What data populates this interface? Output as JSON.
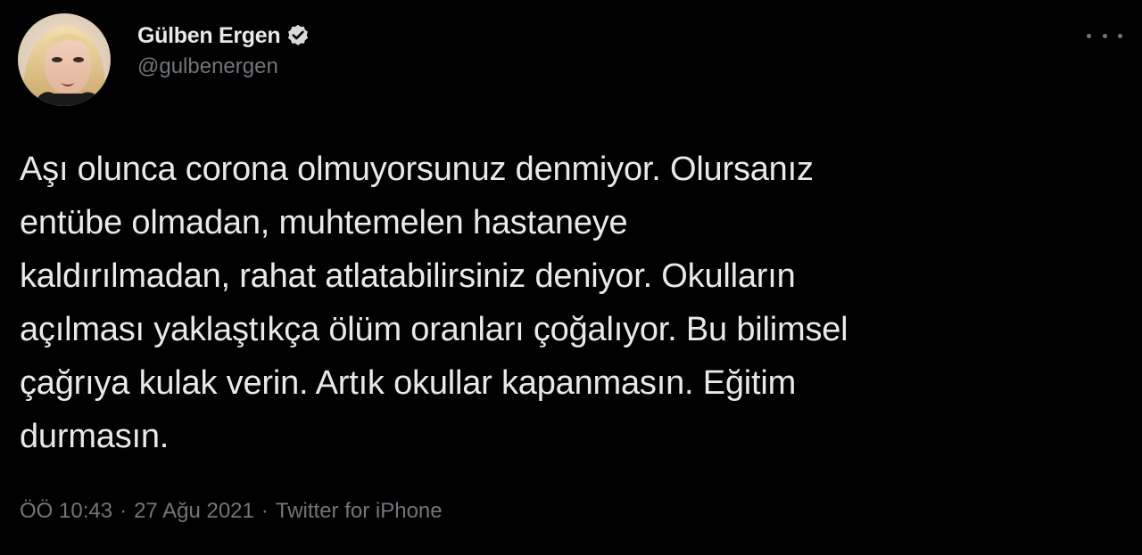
{
  "author": {
    "display_name": "Gülben Ergen",
    "handle": "@gulbenergen",
    "verified_icon": "verified-badge-icon",
    "avatar_icon": "profile-photo"
  },
  "more_icon": "more-options-icon",
  "tweet": {
    "lines": [
      "Aşı olunca corona olmuyorsunuz denmiyor. Olursanız",
      "entübe olmadan, muhtemelen hastaneye",
      "kaldırılmadan, rahat atlatabilirsiniz deniyor. Okulların",
      "açılması yaklaştıkça ölüm oranları çoğalıyor. Bu bilimsel",
      "çağrıya kulak verin. Artık okullar kapanmasın. Eğitim",
      "durmasın."
    ]
  },
  "meta": {
    "time": "ÖÖ 10:43",
    "separator": "·",
    "date": "27 Ağu 2021",
    "source": "Twitter for iPhone"
  },
  "colors": {
    "background": "#000000",
    "text": "#e7e9ea",
    "secondary": "#71767b"
  }
}
